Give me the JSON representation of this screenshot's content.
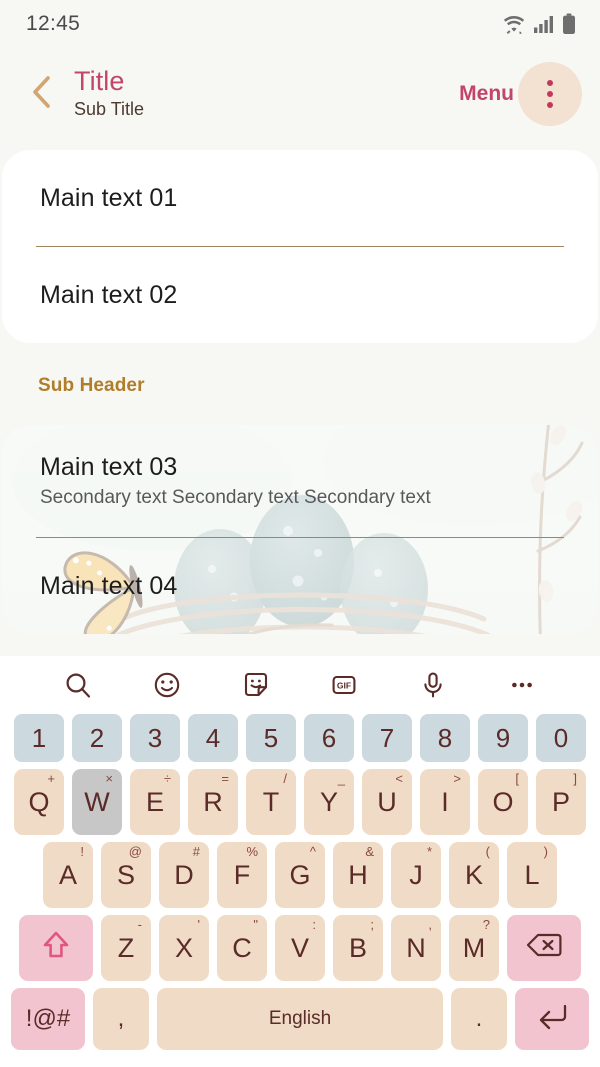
{
  "status_bar": {
    "time": "12:45",
    "icons": [
      "wifi-icon",
      "cellular-signal-icon",
      "battery-icon"
    ]
  },
  "app_bar": {
    "back_icon": "chevron-left-icon",
    "title": "Title",
    "subtitle": "Sub Title",
    "menu_label": "Menu",
    "menu_icon": "more-vertical-icon",
    "colors": {
      "title": "#c2456b",
      "subtitle": "#4c3a2e",
      "back_chevron": "#d2a571",
      "menu_circle_bg": "#f3e2d2"
    }
  },
  "content": {
    "card_one": {
      "rows": [
        {
          "main": "Main text 01"
        },
        {
          "main": "Main text 02"
        }
      ]
    },
    "sub_header": "Sub Header",
    "card_two": {
      "background_image": "birds-nest-watercolor-illustration",
      "rows": [
        {
          "main": "Main text 03",
          "secondary": "Secondary text Secondary text Secondary text"
        },
        {
          "main": "Main text 04"
        }
      ]
    },
    "colors": {
      "divider": "#a08561",
      "sub_header": "#b07d29",
      "page_bg": "#f7f7f4",
      "card_bg": "#ffffff"
    }
  },
  "keyboard": {
    "toolbar": [
      {
        "name": "search-icon",
        "label": "Search"
      },
      {
        "name": "emoji-icon",
        "label": "Emoji"
      },
      {
        "name": "sticker-icon",
        "label": "Sticker"
      },
      {
        "name": "gif-icon",
        "label": "GIF"
      },
      {
        "name": "microphone-icon",
        "label": "Voice input"
      },
      {
        "name": "more-horizontal-icon",
        "label": "More"
      }
    ],
    "number_row": [
      "1",
      "2",
      "3",
      "4",
      "5",
      "6",
      "7",
      "8",
      "9",
      "0"
    ],
    "row_q": [
      {
        "key": "Q",
        "sup": "+"
      },
      {
        "key": "W",
        "sup": "×",
        "pressed": true
      },
      {
        "key": "E",
        "sup": "÷"
      },
      {
        "key": "R",
        "sup": "="
      },
      {
        "key": "T",
        "sup": "/"
      },
      {
        "key": "Y",
        "sup": "_"
      },
      {
        "key": "U",
        "sup": "<"
      },
      {
        "key": "I",
        "sup": ">"
      },
      {
        "key": "O",
        "sup": "["
      },
      {
        "key": "P",
        "sup": "]"
      }
    ],
    "row_a": [
      {
        "key": "A",
        "sup": "!"
      },
      {
        "key": "S",
        "sup": "@"
      },
      {
        "key": "D",
        "sup": "#"
      },
      {
        "key": "F",
        "sup": "%"
      },
      {
        "key": "G",
        "sup": "^"
      },
      {
        "key": "H",
        "sup": "&"
      },
      {
        "key": "J",
        "sup": "*"
      },
      {
        "key": "K",
        "sup": "("
      },
      {
        "key": "L",
        "sup": ")"
      }
    ],
    "row_z": [
      {
        "key": "Z",
        "sup": "-"
      },
      {
        "key": "X",
        "sup": "'"
      },
      {
        "key": "C",
        "sup": "\""
      },
      {
        "key": "V",
        "sup": ":"
      },
      {
        "key": "B",
        "sup": ";"
      },
      {
        "key": "N",
        "sup": ","
      },
      {
        "key": "M",
        "sup": "?"
      }
    ],
    "shift_icon": "shift-arrow-up-icon",
    "backspace_icon": "backspace-delete-icon",
    "bottom_row": {
      "symbols_label": "!@#",
      "comma_label": ",",
      "space_label": "English",
      "period_label": ".",
      "enter_icon": "enter-return-icon"
    },
    "colors": {
      "number_key": "#ccd9df",
      "letter_key": "#f0dcc6",
      "pressed_key": "#c7c7c7",
      "function_key": "#f2c4cf",
      "key_text": "#5a2b28",
      "keyboard_bg": "#ffffff"
    }
  }
}
